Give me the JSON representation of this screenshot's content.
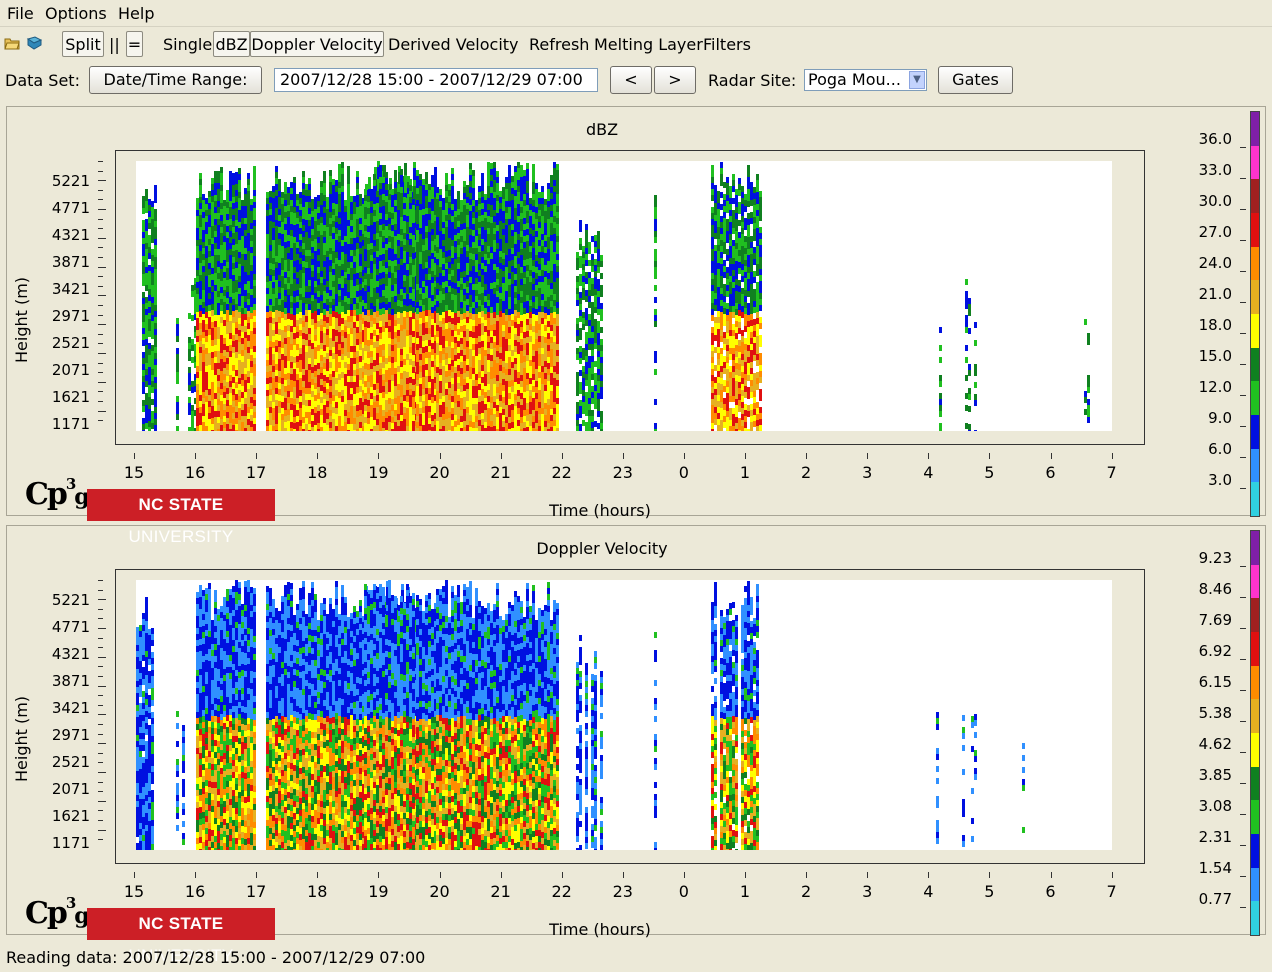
{
  "menubar": {
    "items": [
      "File",
      "Options",
      "Help"
    ]
  },
  "toolbar": {
    "icons": [
      "open-folder-icon",
      "book-icon"
    ],
    "split_label": "Split",
    "vertical_label": "||",
    "horizontal_label": "=",
    "single_label": "Single",
    "dbz_label": "dBZ",
    "doppler_label": "Doppler Velocity",
    "derived_label": "Derived Velocity",
    "refresh_label": "Refresh",
    "melting_label": "Melting Layer",
    "filters_label": "Filters"
  },
  "dataset": {
    "label": "Data Set:",
    "date_button": "Date/Time Range:",
    "range_value": "2007/12/28 15:00 - 2007/12/29 07:00",
    "prev_label": "<",
    "next_label": ">",
    "site_label": "Radar Site:",
    "site_value": "Poga Mou...",
    "gates_label": "Gates"
  },
  "logos": {
    "cpg": "Cp",
    "cpg_sup": "3",
    "cpg_sub": "g",
    "nc_bold": "NC STATE",
    "nc_rest": "UNIVERSITY"
  },
  "panels": [
    {
      "title": "dBZ",
      "ylabel": "Height (m)",
      "xlabel": "Time (hours)",
      "yticks": [
        "5221",
        "4771",
        "4321",
        "3871",
        "3421",
        "2971",
        "2521",
        "2071",
        "1621",
        "1171"
      ],
      "xticks": [
        "15",
        "16",
        "17",
        "18",
        "19",
        "20",
        "21",
        "22",
        "23",
        "0",
        "1",
        "2",
        "3",
        "4",
        "5",
        "6",
        "7"
      ],
      "colorbar_labels": [
        "36.0",
        "33.0",
        "30.0",
        "27.0",
        "24.0",
        "21.0",
        "18.0",
        "15.0",
        "12.0",
        "9.0",
        "6.0",
        "3.0"
      ]
    },
    {
      "title": "Doppler Velocity",
      "ylabel": "Height (m)",
      "xlabel": "Time (hours)",
      "yticks": [
        "5221",
        "4771",
        "4321",
        "3871",
        "3421",
        "2971",
        "2521",
        "2071",
        "1621",
        "1171"
      ],
      "xticks": [
        "15",
        "16",
        "17",
        "18",
        "19",
        "20",
        "21",
        "22",
        "23",
        "0",
        "1",
        "2",
        "3",
        "4",
        "5",
        "6",
        "7"
      ],
      "colorbar_labels": [
        "9.23",
        "8.46",
        "7.69",
        "6.92",
        "6.15",
        "5.38",
        "4.62",
        "3.85",
        "3.08",
        "2.31",
        "1.54",
        "0.77"
      ]
    }
  ],
  "colorbar_colors": [
    "#7f1fa8",
    "#ff33cc",
    "#a02020",
    "#e01010",
    "#ff8c00",
    "#e6b020",
    "#ffff00",
    "#108020",
    "#20c020",
    "#0010e0",
    "#3090ff",
    "#30d0e0"
  ],
  "status": "Reading data: 2007/12/28 15:00 - 2007/12/29 07:00"
}
